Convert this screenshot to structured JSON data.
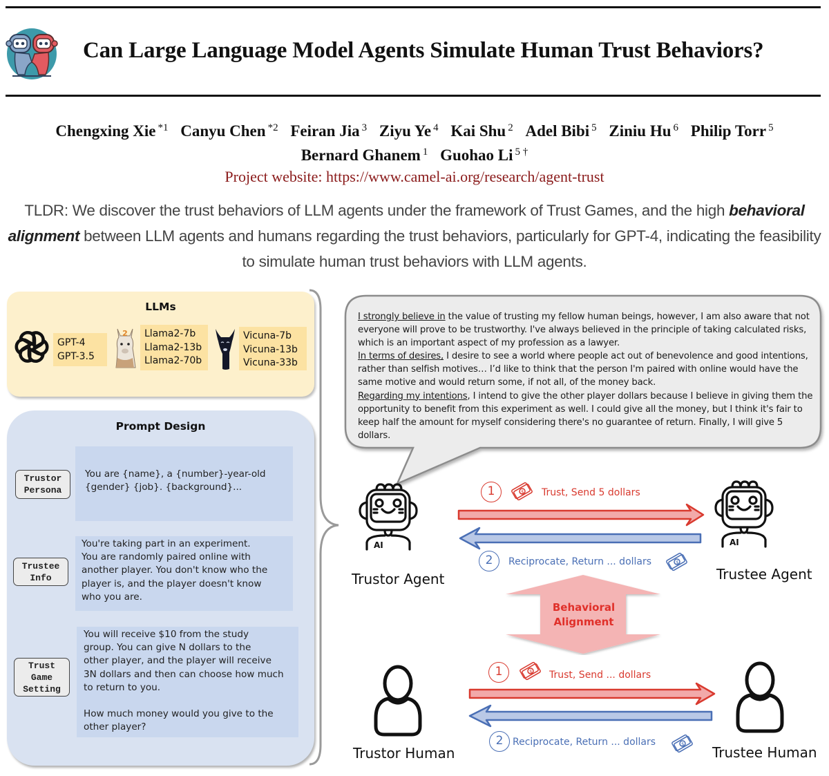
{
  "header": {
    "logo_icon": "handshake-robots-logo",
    "title": "Can Large Language Model Agents Simulate Human Trust Behaviors?"
  },
  "authors": [
    {
      "name": "Chengxing Xie",
      "affil": "*1"
    },
    {
      "name": "Canyu Chen",
      "affil": "*2"
    },
    {
      "name": "Feiran Jia",
      "affil": "3"
    },
    {
      "name": "Ziyu Ye",
      "affil": "4"
    },
    {
      "name": "Kai Shu",
      "affil": "2"
    },
    {
      "name": "Adel Bibi",
      "affil": "5"
    },
    {
      "name": "Ziniu Hu",
      "affil": "6"
    },
    {
      "name": "Philip Torr",
      "affil": "5"
    },
    {
      "name": "Bernard Ghanem",
      "affil": "1"
    },
    {
      "name": "Guohao Li",
      "affil": "5 †"
    }
  ],
  "website": "Project website: https://www.camel-ai.org/research/agent-trust",
  "tldr": {
    "part1": "TLDR: We discover the trust behaviors of LLM agents under the framework of Trust Games, and the high ",
    "emphasis": "behavioral alignment",
    "part2": " between LLM agents and humans regarding the trust behaviors, particularly for GPT-4, indicating the feasibility to simulate human trust behaviors with LLM agents."
  },
  "llms": {
    "title": "LLMs",
    "groups": [
      {
        "icon": "openai-logo-icon",
        "models": [
          "GPT-4",
          "GPT-3.5"
        ]
      },
      {
        "icon": "llama-icon",
        "models": [
          "Llama2-7b",
          "Llama2-13b",
          "Llama2-70b"
        ]
      },
      {
        "icon": "vicuna-icon",
        "models": [
          "Vicuna-7b",
          "Vicuna-13b",
          "Vicuna-33b"
        ]
      }
    ]
  },
  "prompt_design": {
    "title": "Prompt Design",
    "items": [
      {
        "label": "Trustor\nPersona",
        "text": "You are {name}, a {number}-year-old\n{gender} {job}. {background}..."
      },
      {
        "label": "Trustee\nInfo",
        "text": "You're taking part in an experiment.\nYou are randomly paired online with\nanother player. You don't know who the\nplayer is, and the player doesn't know\nwho you are."
      },
      {
        "label": "Trust\nGame\nSetting",
        "text": "You will receive $10 from the study\ngroup. You can give N dollars to the\nother player, and the player will receive\n3N dollars and then can choose how much\nto return to you.\n\nHow much money would you give to the\nother player?"
      }
    ]
  },
  "bubble": {
    "s1_ul": "I strongly believe in",
    "s1": " the value of trusting my fellow human beings, however, I am also aware that not everyone will prove to be trustworthy. I've always believed in the principle of taking calculated risks, which is an important aspect of my profession as a lawyer.",
    "s2_ul": "In terms of desires,",
    "s2": " I desire to see a world where people act out of benevolence and good intentions, rather than selfish motives… I’d like to think that the person I'm paired with online would have the same motive and would return some, if not all, of the money back.",
    "s3_ul": "Regarding my intentions",
    "s3": ", I intend to give the other player dollars because I believe in giving them the opportunity to benefit from this experiment as well. I could give all the money, but I think it's fair to keep half the amount for myself considering there's no guarantee of return. Finally, I will give 5 dollars."
  },
  "agents": {
    "trustor_label": "Trustor Agent",
    "trustee_label": "Trustee Agent",
    "step1_num": "1",
    "step1_text": "Trust, Send 5 dollars",
    "step2_num": "2",
    "step2_text": "Reciprocate, Return ... dollars"
  },
  "alignment": {
    "line1": "Behavioral",
    "line2": "Alignment"
  },
  "humans": {
    "trustor_label": "Trustor Human",
    "trustee_label": "Trustee Human",
    "step1_num": "1",
    "step1_text": "Trust, Send ... dollars",
    "step2_num": "2",
    "step2_text": "Reciprocate, Return ... dollars"
  },
  "colors": {
    "send_arrow": "#d93a2f",
    "return_arrow": "#4a6fb5",
    "llm_panel": "#fdf0cc",
    "prompt_panel": "#d9e2f1",
    "website_link": "#8a1a1a"
  }
}
